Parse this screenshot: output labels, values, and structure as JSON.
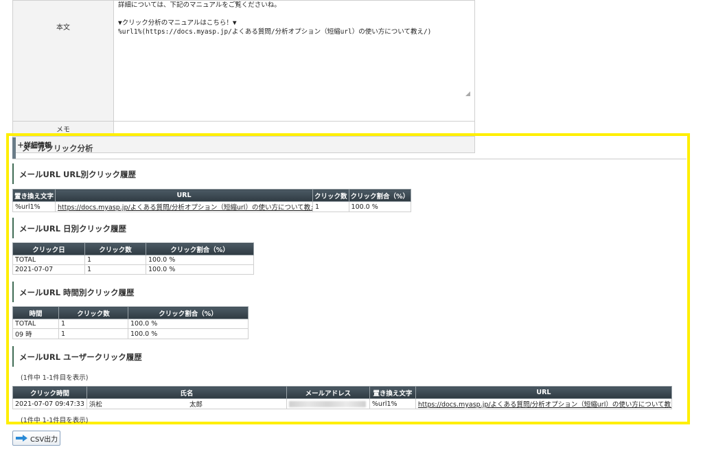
{
  "form": {
    "body_label": "本文",
    "body_text": "詳細については、下記のマニュアルをご覧くださいね。\n\n▼クリック分析のマニュアルはこちら！▼\n%url1%(https://docs.myasp.jp/よくある質問/分析オプション（短縮url）の使い方について教え/)",
    "memo_label": "メモ",
    "memo_value": "",
    "details_toggle": "＋詳細情報"
  },
  "section": {
    "title": "メールクリック分析"
  },
  "url_history": {
    "title": "メールURL URL別クリック履歴",
    "headers": [
      "置き換え文字",
      "URL",
      "クリック数",
      "クリック割合（%）"
    ],
    "rows": [
      [
        "%url1%",
        "https://docs.myasp.jp/よくある質問/分析オプション（短縮url）の使い方について教え/",
        "1",
        "100.0 %"
      ]
    ]
  },
  "daily_history": {
    "title": "メールURL 日別クリック履歴",
    "headers": [
      "クリック日",
      "クリック数",
      "クリック割合（%）"
    ],
    "rows": [
      [
        "TOTAL",
        "1",
        "100.0 %"
      ],
      [
        "2021-07-07",
        "1",
        "100.0 %"
      ]
    ]
  },
  "hourly_history": {
    "title": "メールURL 時間別クリック履歴",
    "headers": [
      "時間",
      "クリック数",
      "クリック割合（%）"
    ],
    "rows": [
      [
        "TOTAL",
        "1",
        "100.0 %"
      ],
      [
        "09 時",
        "1",
        "100.0 %"
      ]
    ]
  },
  "user_history": {
    "title": "メールURL ユーザークリック履歴",
    "count_text": "(1件中 1-1件目を表示)",
    "headers": [
      "クリック時間",
      "氏名",
      "メールアドレス",
      "置き換え文字",
      "URL"
    ],
    "row": {
      "time": "2021-07-07 09:47:33",
      "last_name": "浜松",
      "first_name": "太郎",
      "email": "",
      "replace": "%url1%",
      "url": "https://docs.myasp.jp/よくある質問/分析オプション（短縮url）の使い方について教え/"
    },
    "count_text_bottom": "(1件中 1-1件目を表示)"
  },
  "csv_button": {
    "label": "CSV出力",
    "icon": "arrow-right-icon"
  },
  "colors": {
    "highlight": "#ffef00",
    "header_bg": "#3a464e",
    "subhead_bar": "#3f6b54"
  }
}
